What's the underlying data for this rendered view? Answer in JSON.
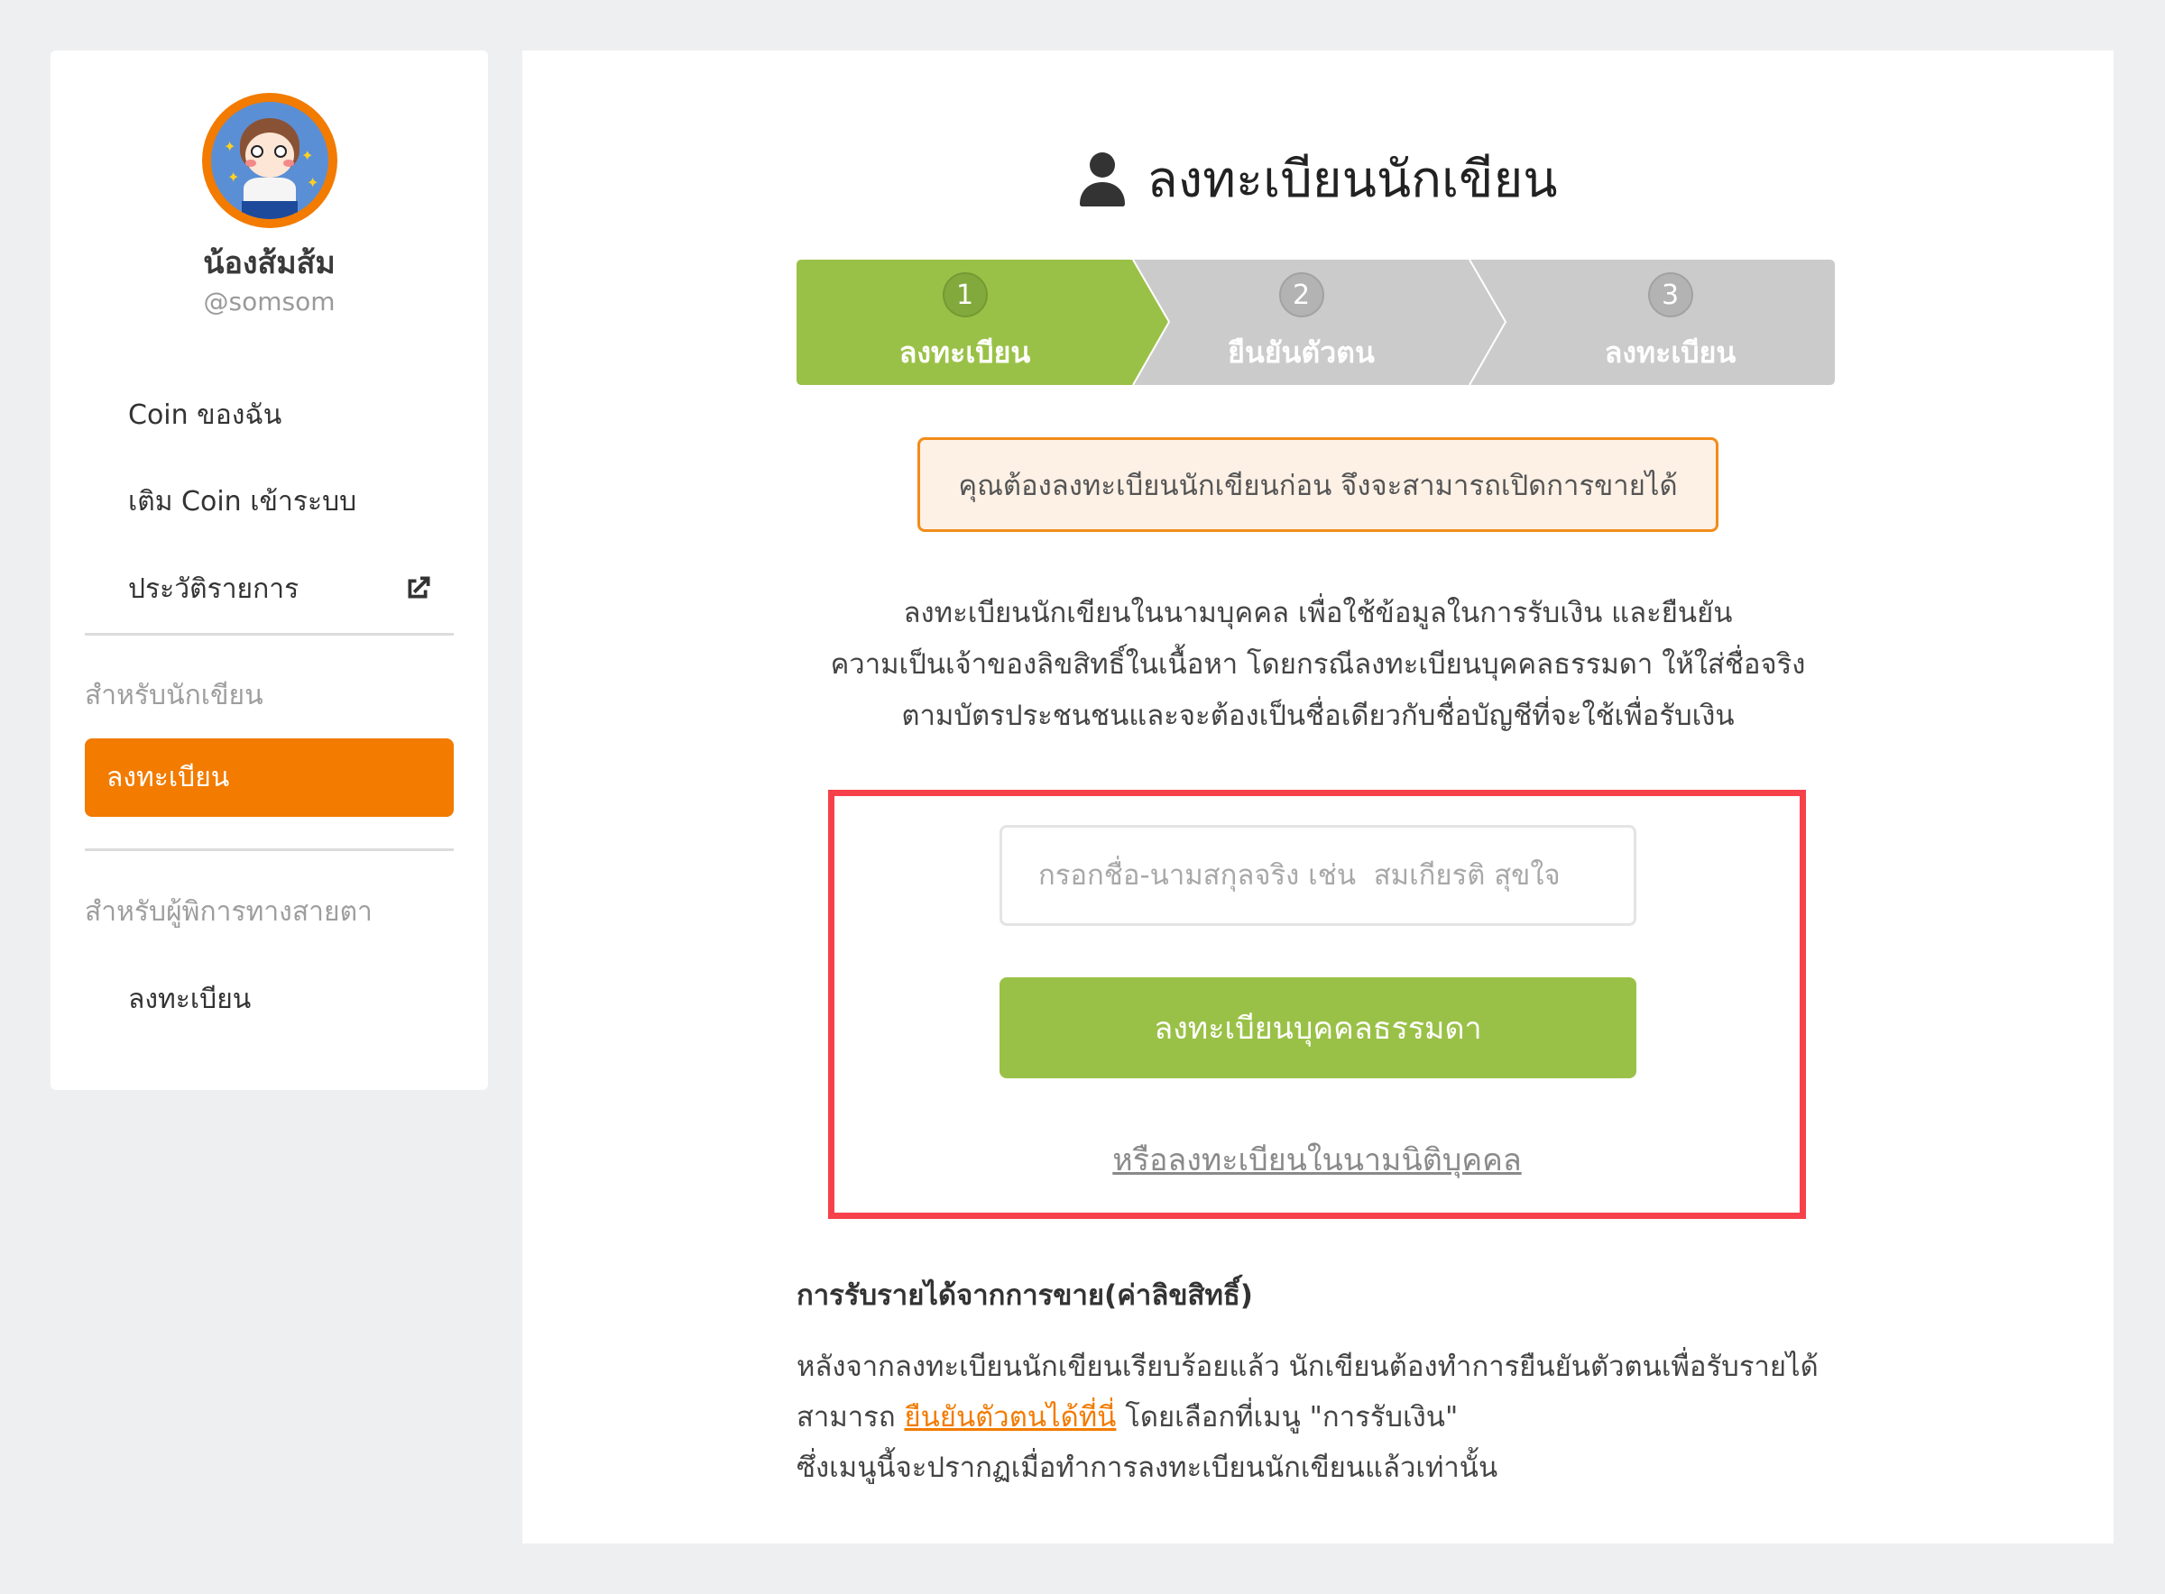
{
  "sidebar": {
    "user": {
      "display_name": "น้องส้มส้ม",
      "handle": "@somsom",
      "avatar_ring_color": "#f27b00"
    },
    "menu": [
      {
        "label": "Coin ของฉัน"
      },
      {
        "label": "เติม Coin เข้าระบบ"
      },
      {
        "label": "ประวัติรายการ",
        "icon": "external-link-icon"
      }
    ],
    "writer_section": {
      "label": "สำหรับนักเขียน",
      "items": [
        {
          "label": "ลงทะเบียน",
          "active": true
        }
      ]
    },
    "blind_section": {
      "label": "สำหรับผู้พิการทางสายตา",
      "items": [
        {
          "label": "ลงทะเบียน",
          "active": false
        }
      ]
    },
    "accent_color": "#f27b00"
  },
  "main": {
    "title": "ลงทะเบียนนักเขียน",
    "title_icon": "user-icon",
    "stepper": {
      "current_step": 1,
      "steps": [
        {
          "number": "1",
          "label": "ลงทะเบียน",
          "state": "active"
        },
        {
          "number": "2",
          "label": "ยืนยันตัวตน",
          "state": "inactive"
        },
        {
          "number": "3",
          "label": "ลงทะเบียน",
          "state": "inactive"
        }
      ],
      "active_color": "#9ac147",
      "inactive_color": "#cbcbcb"
    },
    "alert": "คุณต้องลงทะเบียนนักเขียนก่อน จึงจะสามารถเปิดการขายได้",
    "description": [
      "ลงทะเบียนนักเขียนในนามบุคคล เพื่อใช้ข้อมูลในการรับเงิน และยืนยัน",
      "ความเป็นเจ้าของลิขสิทธิ์ในเนื้อหา โดยกรณีลงทะเบียนบุคคลธรรมดา ให้ใส่ชื่อจริง",
      "ตามบัตรประชนชนและจะต้องเป็นชื่อเดียวกับชื่อบัญชีที่จะใช้เพื่อรับเงิน"
    ],
    "form": {
      "name_input": {
        "value": "",
        "placeholder": "กรอกชื่อ-นามสกุลจริง เช่น  สมเกียรติ สุขใจ"
      },
      "register_button": "ลงทะเบียนบุคคลธรรมดา",
      "juristic_link": "หรือลงทะเบียนในนามนิติบุคคล",
      "highlight_color": "#f6414a"
    },
    "income": {
      "title": "การรับรายได้จากการขาย(ค่าลิขสิทธิ์)",
      "line1": "หลังจากลงทะเบียนนักเขียนเรียบร้อยแล้ว นักเขียนต้องทำการยืนยันตัวตนเพื่อรับรายได้",
      "line2_prefix": "สามารถ ",
      "line2_link": "ยืนยันตัวตนได้ที่นี่",
      "line2_suffix": " โดยเลือกที่เมนู \"การรับเงิน\"",
      "line3": "ซึ่งเมนูนี้จะปรากฏเมื่อทำการลงทะเบียนนักเขียนแล้วเท่านั้น"
    }
  }
}
